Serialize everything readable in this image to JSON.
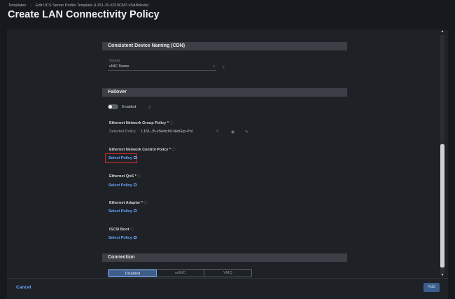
{
  "breadcrumb": [
    "Templates",
    "Edit UCS Server Profile Template (L151-J5-X210CM7-vSANNode)"
  ],
  "page_title": "Create LAN Connectivity Policy",
  "cdn": {
    "section_title": "Consistent Device Naming (CDN)",
    "source_label": "Source",
    "source_value": "vNIC Name"
  },
  "failover": {
    "section_title": "Failover",
    "toggle_label": "Enabled",
    "network_group": {
      "label": "Ethernet Network Group Policy *",
      "selected_label": "Selected Policy",
      "selected_value": "L151-J5-vSwitch0-NetGrp-Pol"
    },
    "network_control": {
      "label": "Ethernet Network Control Policy *",
      "link": "Select Policy"
    },
    "qos": {
      "label": "Ethernet QoS *",
      "link": "Select Policy"
    },
    "adapter": {
      "label": "Ethernet Adapter *",
      "link": "Select Policy"
    },
    "iscsi": {
      "label": "iSCSI Boot",
      "link": "Select Policy"
    }
  },
  "connection": {
    "section_title": "Connection",
    "options": [
      "Disabled",
      "usNIC",
      "VMQ"
    ],
    "selected": "Disabled"
  },
  "footer": {
    "cancel": "Cancel",
    "add": "Add"
  },
  "colors": {
    "accent": "#6aa6ff",
    "highlight": "#d12b2b"
  },
  "icons": {
    "info": "info-icon",
    "external": "external-link-icon",
    "eye": "eye-icon",
    "edit": "pencil-icon",
    "close": "close-icon",
    "chevron": "chevron-down-icon"
  }
}
